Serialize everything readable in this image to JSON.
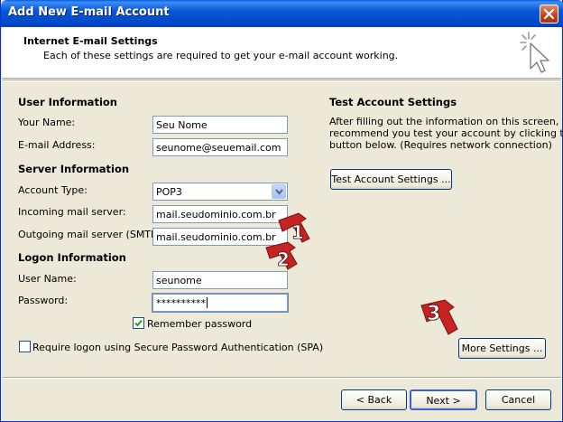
{
  "window": {
    "title": "Add New E-mail Account"
  },
  "header": {
    "title": "Internet E-mail Settings",
    "description": "Each of these settings are required to get your e-mail account working."
  },
  "user_info": {
    "section_title": "User Information",
    "name_label": "Your Name:",
    "name_value": "Seu Nome",
    "email_label": "E-mail Address:",
    "email_value": "seunome@seuemail.com"
  },
  "server_info": {
    "section_title": "Server Information",
    "account_type_label": "Account Type:",
    "account_type_value": "POP3",
    "incoming_label": "Incoming mail server:",
    "incoming_value": "mail.seudominio.com.br",
    "outgoing_label": "Outgoing mail server (SMTP):",
    "outgoing_value": "mail.seudominio.com.br"
  },
  "logon_info": {
    "section_title": "Logon Information",
    "username_label": "User Name:",
    "username_value": "seunome",
    "password_label": "Password:",
    "password_value": "**********",
    "remember_label": "Remember password",
    "remember_checked": true,
    "spa_label": "Require logon using Secure Password Authentication (SPA)",
    "spa_checked": false
  },
  "test_settings": {
    "section_title": "Test Account Settings",
    "description_line1": "After filling out the information on this screen, we",
    "description_line2": "recommend you test your account by clicking the",
    "description_line3": "button below. (Requires network connection)",
    "test_button": "Test Account Settings ..."
  },
  "more_settings_button": "More Settings ...",
  "footer": {
    "back": "< Back",
    "next": "Next >",
    "cancel": "Cancel"
  },
  "annotations": {
    "badge1": "1",
    "badge2": "2",
    "badge3": "3",
    "badge_color": "#d52b2b"
  }
}
